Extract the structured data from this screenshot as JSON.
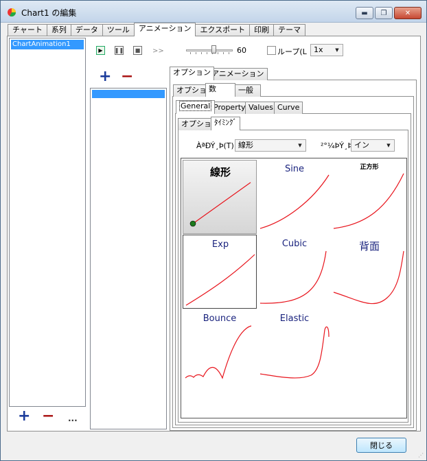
{
  "window": {
    "title": "Chart1 の編集",
    "min": "▬",
    "max": "❐",
    "close": "✕"
  },
  "main_tabs": [
    {
      "label": "チャート",
      "active": false
    },
    {
      "label": "系列",
      "active": false
    },
    {
      "label": "データ",
      "active": false
    },
    {
      "label": "ツール",
      "active": false
    },
    {
      "label": "アニメーション",
      "active": true
    },
    {
      "label": "エクスポート",
      "active": false
    },
    {
      "label": "印刷",
      "active": false
    },
    {
      "label": "テーマ",
      "active": false
    }
  ],
  "animations_list": {
    "items": [
      "ChartAnimation1"
    ],
    "add": "+",
    "remove": "−",
    "more": "..."
  },
  "player": {
    "play": "▶",
    "pause": "❚❚",
    "stop": "■",
    "fast_forward": ">>",
    "speed_value": "60",
    "speed_fraction": 0.6,
    "loop_label": "ループ(L",
    "loop_checked": false,
    "rate": "1x",
    "dropdown_arrow": "▼"
  },
  "sub_list": {
    "add": "+",
    "remove": "−"
  },
  "tabs_level1": [
    {
      "label": "オプション",
      "active": true
    },
    {
      "label": "アニメーション",
      "active": false
    }
  ],
  "tabs_level2": [
    {
      "label": "オプション",
      "active": false
    },
    {
      "label": "数",
      "active": true
    },
    {
      "label": "一般",
      "active": false
    }
  ],
  "tabs_level3": [
    {
      "label": "General",
      "active": true
    },
    {
      "label": "Property",
      "active": false
    },
    {
      "label": "Values",
      "active": false
    },
    {
      "label": "Curve",
      "active": false
    }
  ],
  "tabs_level4": [
    {
      "label": "オプション",
      "active": false
    },
    {
      "label": "ﾀｲﾐﾝｸﾞ",
      "active": true
    }
  ],
  "timing": {
    "curve_label": "ÀªÐÝ¸Þ(T):",
    "curve_value": "線形",
    "direction_label": "²°¼ÞÝ¸Þ(",
    "direction_value": "イン"
  },
  "curves": [
    {
      "label": "線形",
      "selected": true
    },
    {
      "label": "Sine",
      "selected": false
    },
    {
      "label": "正方形",
      "selected": false
    },
    {
      "label": "Exp",
      "selected": false
    },
    {
      "label": "Cubic",
      "selected": false
    },
    {
      "label": "背面",
      "selected": false
    },
    {
      "label": "Bounce",
      "selected": false
    },
    {
      "label": "Elastic",
      "selected": false
    }
  ],
  "footer": {
    "close_label": "閉じる"
  },
  "colors": {
    "accent": "#3399ff",
    "curve": "#e8141c",
    "add": "#1a3a9a",
    "remove": "#aa1515"
  }
}
